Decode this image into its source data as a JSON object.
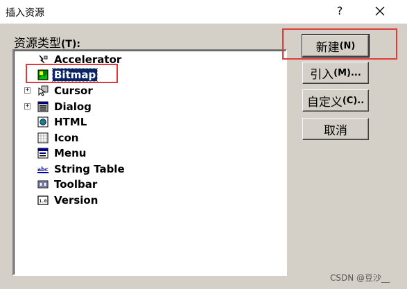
{
  "window": {
    "title": "插入资源",
    "help_label": "?",
    "close_icon": "close-icon"
  },
  "resource_type_label": "资源类型",
  "resource_type_accel": "(T):",
  "tree": [
    {
      "label": "Accelerator",
      "icon": "accelerator-icon",
      "expandable": false
    },
    {
      "label": "Bitmap",
      "icon": "bitmap-icon",
      "expandable": false,
      "selected": true
    },
    {
      "label": "Cursor",
      "icon": "cursor-icon",
      "expandable": true
    },
    {
      "label": "Dialog",
      "icon": "dialog-icon",
      "expandable": true
    },
    {
      "label": "HTML",
      "icon": "html-icon",
      "expandable": false
    },
    {
      "label": "Icon",
      "icon": "icon-resource-icon",
      "expandable": false
    },
    {
      "label": "Menu",
      "icon": "menu-icon",
      "expandable": false
    },
    {
      "label": "String Table",
      "icon": "string-table-icon",
      "expandable": false
    },
    {
      "label": "Toolbar",
      "icon": "toolbar-icon",
      "expandable": false
    },
    {
      "label": "Version",
      "icon": "version-icon",
      "expandable": false
    }
  ],
  "expander_symbol": "+",
  "buttons": {
    "new": {
      "label": "新建",
      "accel": "(N)"
    },
    "import": {
      "label": "引入",
      "accel": "(M)..."
    },
    "custom": {
      "label": "自定义",
      "accel": "(C).."
    },
    "cancel": {
      "label": "取消"
    }
  },
  "watermark": "CSDN @豆沙__",
  "colors": {
    "selection": "#0a246a",
    "annotation": "#e03a3a",
    "dialog_face": "#d4d0c8"
  }
}
